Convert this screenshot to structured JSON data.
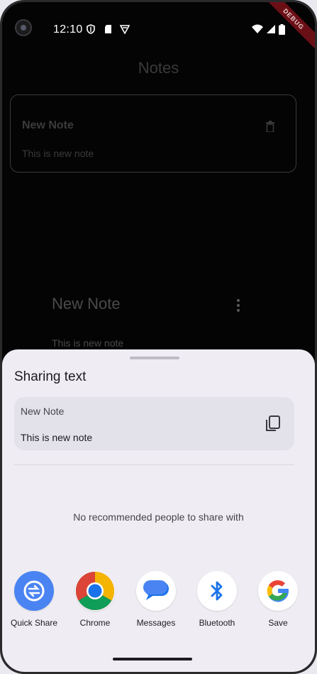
{
  "status_bar": {
    "time": "12:10",
    "left_icons": [
      "shield-icon",
      "sd-card-icon",
      "vpn-icon"
    ],
    "right_icons": [
      "wifi-icon",
      "signal-icon",
      "battery-icon"
    ],
    "debug_banner": "DEBUG"
  },
  "app": {
    "title": "Notes",
    "note_card": {
      "title": "New Note",
      "body": "This is new note",
      "delete_icon": "trash-icon"
    },
    "dialog": {
      "title": "New Note",
      "body": "This is new note",
      "menu_icon": "more-vert-icon"
    }
  },
  "share_sheet": {
    "title": "Sharing text",
    "preview": {
      "title": "New Note",
      "body": "This is new note",
      "copy_icon": "copy-icon"
    },
    "no_people_text": "No recommended people to share with",
    "targets": [
      {
        "label": "Quick Share",
        "icon": "quick-share-icon"
      },
      {
        "label": "Chrome",
        "icon": "chrome-icon"
      },
      {
        "label": "Messages",
        "icon": "messages-icon"
      },
      {
        "label": "Bluetooth",
        "icon": "bluetooth-icon"
      },
      {
        "label": "Save",
        "icon": "google-icon"
      }
    ]
  },
  "colors": {
    "sheet_bg": "#efedf3",
    "preview_bg": "#e3e1ea",
    "quick_share_blue": "#4a84f3",
    "bluetooth_blue": "#1a73e8"
  }
}
